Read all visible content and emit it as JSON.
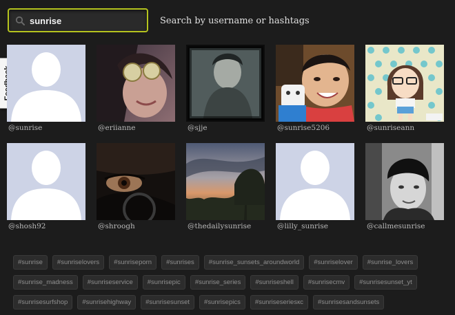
{
  "search": {
    "value": "sunrise",
    "icon": "search-icon"
  },
  "hint": "Search by username or hashtags",
  "feedback_label": "Feedback",
  "users": [
    {
      "username": "@sunrise",
      "avatar": "default-avatar"
    },
    {
      "username": "@eriianne",
      "avatar": "photo-girl-sunglasses"
    },
    {
      "username": "@sjje",
      "avatar": "photo-man-portrait"
    },
    {
      "username": "@sunrise5206",
      "avatar": "photo-child-toy"
    },
    {
      "username": "@sunriseann",
      "avatar": "cartoon-girl-polka-dots"
    },
    {
      "username": "@shosh92",
      "avatar": "default-avatar"
    },
    {
      "username": "@shroogh",
      "avatar": "photo-eye-closeup"
    },
    {
      "username": "@thedailysunrise",
      "avatar": "photo-sunset-trees"
    },
    {
      "username": "@lilly_sunrise",
      "avatar": "default-avatar"
    },
    {
      "username": "@callmesunrise",
      "avatar": "photo-man-beanie"
    }
  ],
  "tag_rows": [
    [
      "#sunrise",
      "#sunriselovers",
      "#sunriseporn",
      "#sunrises",
      "#sunrise_sunsets_aroundworld",
      "#sunriselover",
      "#sunrise_lovers"
    ],
    [
      "#sunrise_madness",
      "#sunriseservice",
      "#sunrisepic",
      "#sunrise_series",
      "#sunriseshell",
      "#sunrisecmv",
      "#sunrisesunset_yt"
    ],
    [
      "#sunrisesurfshop",
      "#sunrisehighway",
      "#sunrisesunset",
      "#sunrisepics",
      "#sunriseseriesкc",
      "#sunrisesandsunsets"
    ]
  ],
  "colors": {
    "accent": "#b5c41e",
    "background": "#1c1c1c",
    "placeholder_avatar_bg": "#cdd3e6"
  }
}
